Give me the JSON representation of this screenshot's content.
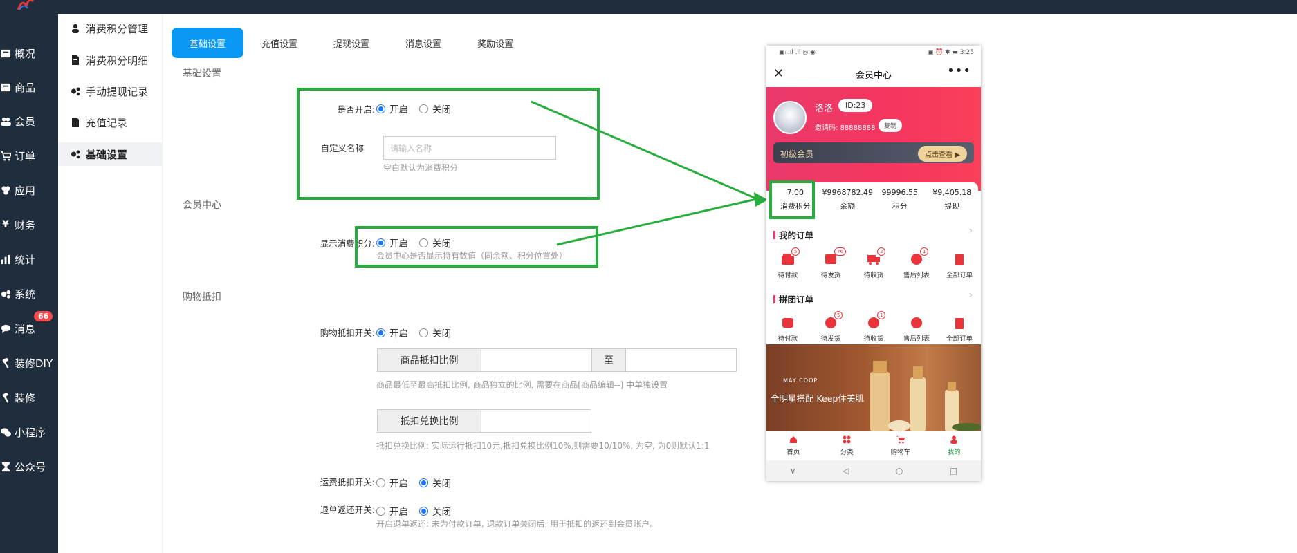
{
  "topbar": {},
  "main_nav": [
    {
      "label": "概况",
      "icon": "overview-icon"
    },
    {
      "label": "商品",
      "icon": "goods-icon"
    },
    {
      "label": "会员",
      "icon": "members-icon"
    },
    {
      "label": "订单",
      "icon": "cart-icon"
    },
    {
      "label": "应用",
      "icon": "apps-icon"
    },
    {
      "label": "财务",
      "icon": "yen-icon"
    },
    {
      "label": "统计",
      "icon": "bar-chart-icon"
    },
    {
      "label": "系统",
      "icon": "gears-icon"
    },
    {
      "label": "消息",
      "icon": "message-icon"
    },
    {
      "label": "装修DIY",
      "icon": "hammer-icon"
    },
    {
      "label": "装修",
      "icon": "hammer-icon"
    },
    {
      "label": "小程序",
      "icon": "wechat-icon"
    },
    {
      "label": "公众号",
      "icon": "hourglass-icon"
    }
  ],
  "message_badge": "66",
  "sub_nav": [
    {
      "label": "消费积分管理",
      "icon": "user-icon"
    },
    {
      "label": "消费积分明细",
      "icon": "file-icon"
    },
    {
      "label": "手动提现记录",
      "icon": "gears-icon"
    },
    {
      "label": "充值记录",
      "icon": "file-icon"
    },
    {
      "label": "基础设置",
      "icon": "gears-icon",
      "active": true
    }
  ],
  "tabs": [
    "基础设置",
    "充值设置",
    "提现设置",
    "消息设置",
    "奖励设置"
  ],
  "sections": {
    "basic": "基础设置",
    "member_center": "会员中心",
    "shopping_deduct": "购物抵扣"
  },
  "form": {
    "enable_label": "是否开启:",
    "on": "开启",
    "off": "关闭",
    "custom_name_label": "自定义名称",
    "custom_name_placeholder": "请输入名称",
    "custom_name_hint": "空白默认为消费积分",
    "show_points_label": "显示消费积分:",
    "show_points_hint": "会员中心是否显示持有数值（同余额、积分位置处）",
    "deduct_switch_label": "购物抵扣开关:",
    "goods_ratio_label": "商品抵扣比例",
    "to": "至",
    "goods_ratio_hint": "商品最低至最高抵扣比例, 商品独立的比例, 需要在商品[商品编辑--] 中单独设置",
    "exchange_ratio_label": "抵扣兑换比例",
    "exchange_ratio_hint": "抵扣兑换比例: 实际运行抵扣10元,抵扣兑换比例10%,则需要10/10%, 为空, 为0则默认1:1",
    "freight_label": "运费抵扣开关:",
    "refund_label": "退单返还开关:",
    "refund_hint": "开启退单返还: 未为付款订单, 退款订单关闭后, 用于抵扣的返还到会员账户。"
  },
  "phone": {
    "status_left": "▣ᵢ .ıl .ıl ◎ ◉",
    "status_right": "▣ ⏰ ✱ ▬ 3:25",
    "title": "会员中心",
    "close": "✕",
    "more": "•••",
    "username": "洛洛",
    "user_id": "ID:23",
    "invite": "邀请码: 88888888",
    "copy": "复制",
    "level": "初级会员",
    "level_btn": "点击查看 ▶",
    "stats": [
      {
        "value": "7.00",
        "label": "消费积分"
      },
      {
        "value": "¥9968782.49",
        "label": "余额"
      },
      {
        "value": "99996.55",
        "label": "积分"
      },
      {
        "value": "¥9,405.18",
        "label": "提现"
      }
    ],
    "my_orders": "我的订单",
    "order_items": [
      {
        "label": "待付款",
        "count": "5"
      },
      {
        "label": "待发货",
        "count": "76"
      },
      {
        "label": "待收货",
        "count": "2"
      },
      {
        "label": "售后列表",
        "count": "1"
      },
      {
        "label": "全部订单",
        "count": ""
      }
    ],
    "group_orders": "拼团订单",
    "group_items": [
      {
        "label": "待付款",
        "count": ""
      },
      {
        "label": "待发货",
        "count": "5"
      },
      {
        "label": "待收货",
        "count": "1"
      },
      {
        "label": "售后列表",
        "count": ""
      },
      {
        "label": "全部订单",
        "count": ""
      }
    ],
    "banner_brand": "MAY COOP",
    "banner_slogan": "全明星搭配 Keep住美肌",
    "tabbar": [
      {
        "label": "首页"
      },
      {
        "label": "分类"
      },
      {
        "label": "购物车"
      },
      {
        "label": "我的",
        "active": true
      }
    ],
    "sys_buttons": [
      "∨",
      "◁",
      "○",
      "□"
    ]
  },
  "colors": {
    "accent": "#0a98f5",
    "highlight_box": "#27ad3d",
    "brand_red": "#e9396a"
  }
}
